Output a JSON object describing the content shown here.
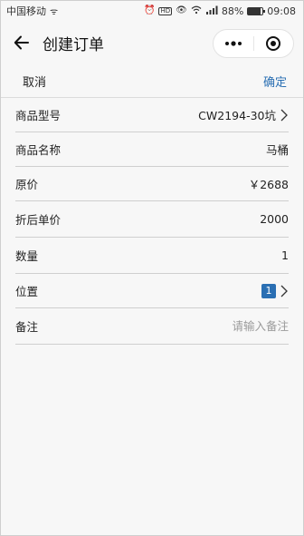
{
  "status_bar": {
    "carrier": "中国移动",
    "carrier_extra": "ᯤ",
    "signal_text": "4G",
    "battery_percent": "88%",
    "battery_level": 0.88,
    "time": "09:08"
  },
  "nav": {
    "title": "创建订单"
  },
  "actions": {
    "cancel": "取消",
    "confirm": "确定"
  },
  "form": {
    "rows": [
      {
        "label": "商品型号",
        "value": "CW2194-30坑"
      },
      {
        "label": "商品名称",
        "value": "马桶"
      },
      {
        "label": "原价",
        "value": "￥2688"
      },
      {
        "label": "折后单价",
        "value": "2000"
      },
      {
        "label": "数量",
        "value": "1"
      },
      {
        "label": "位置",
        "value": "1"
      },
      {
        "label": "备注",
        "placeholder": "请输入备注"
      }
    ]
  },
  "colors": {
    "accent": "#2a6fb3",
    "background": "#f7f7f7",
    "divider": "#cfcfcf"
  },
  "icons": {
    "back": "arrow-left-icon",
    "more": "more-dots-icon",
    "close": "target-circle-icon",
    "chevron": "chevron-right-icon"
  }
}
